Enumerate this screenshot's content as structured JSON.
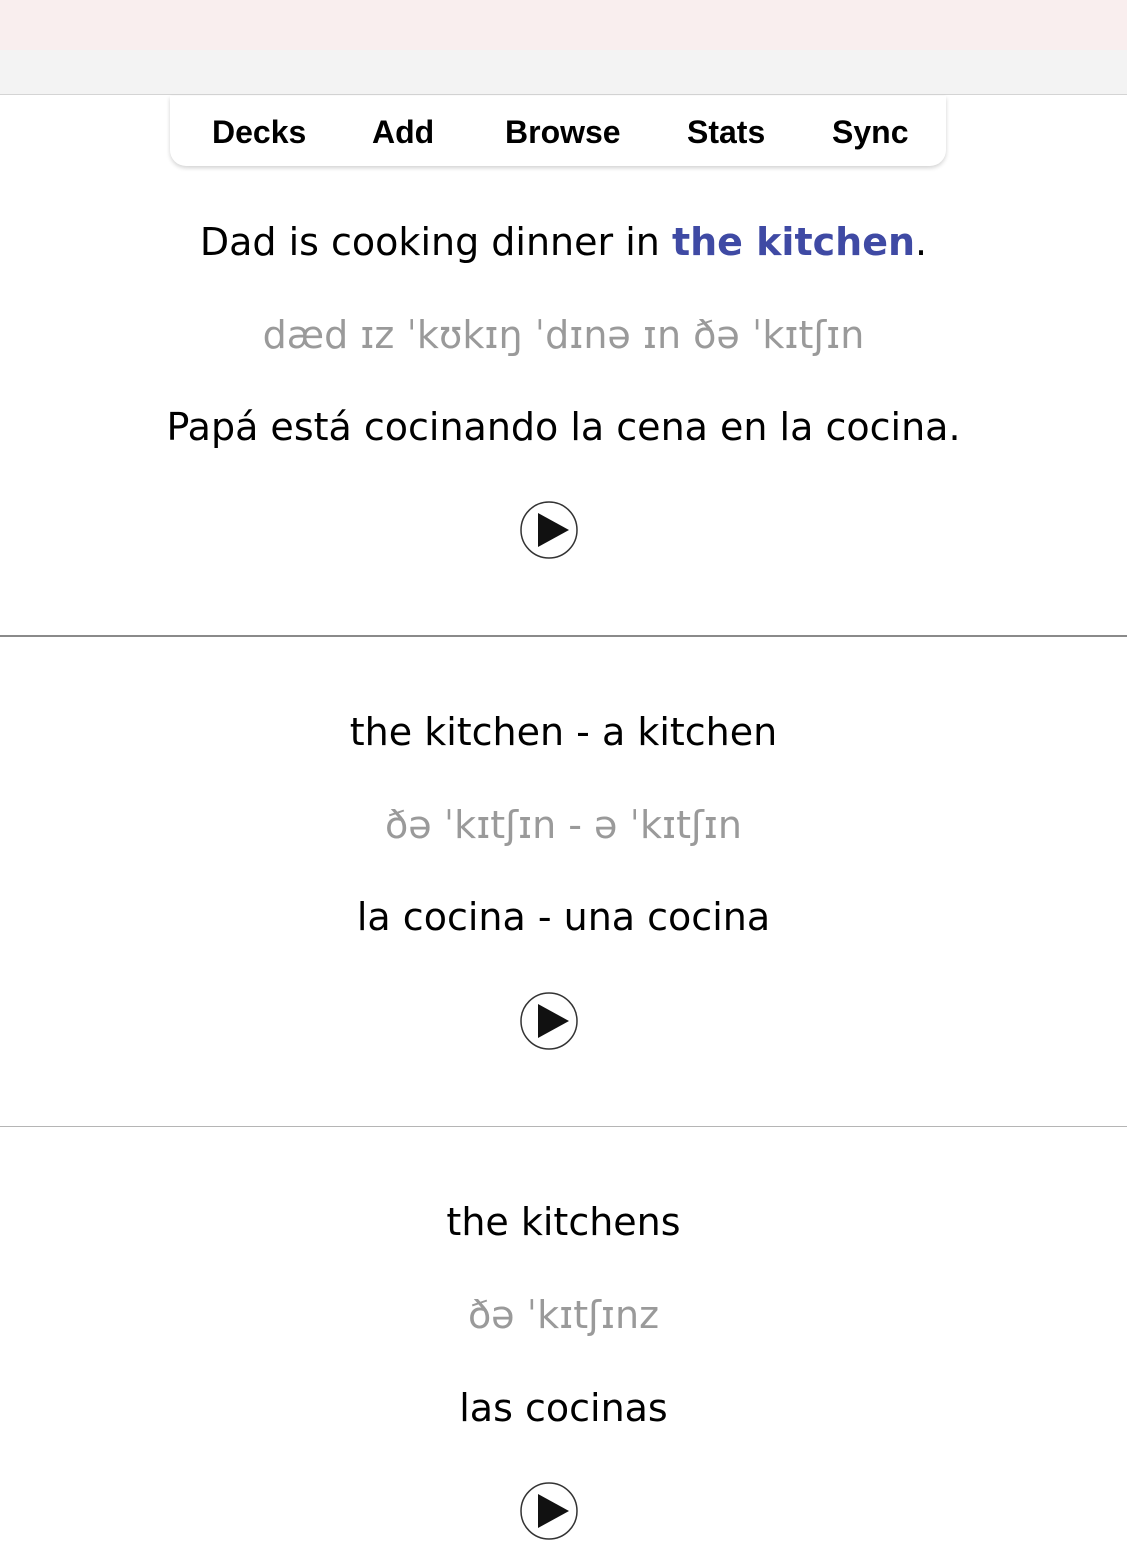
{
  "nav": {
    "items": [
      "Decks",
      "Add",
      "Browse",
      "Stats",
      "Sync"
    ]
  },
  "card": {
    "sentence": {
      "before": "Dad is cooking dinner in ",
      "highlight": "the kitchen",
      "after": ".",
      "ipa": "dæd ɪz ˈkʊkɪŋ ˈdɪnə ɪn ðə ˈkɪtʃɪn",
      "translation": "Papá está cocinando la cena en la cocina."
    },
    "singular": {
      "text": "the kitchen - a kitchen",
      "ipa": "ðə ˈkɪtʃɪn - ə ˈkɪtʃɪn",
      "translation": "la cocina - una cocina"
    },
    "plural": {
      "text": "the kitchens",
      "ipa": "ðə ˈkɪtʃɪnz",
      "translation": "las cocinas"
    }
  },
  "icons": {
    "play": "play-icon"
  },
  "colors": {
    "highlight": "#3f4aa4",
    "ipa": "#9a9a9a",
    "titlebar": "#f9eeee"
  }
}
